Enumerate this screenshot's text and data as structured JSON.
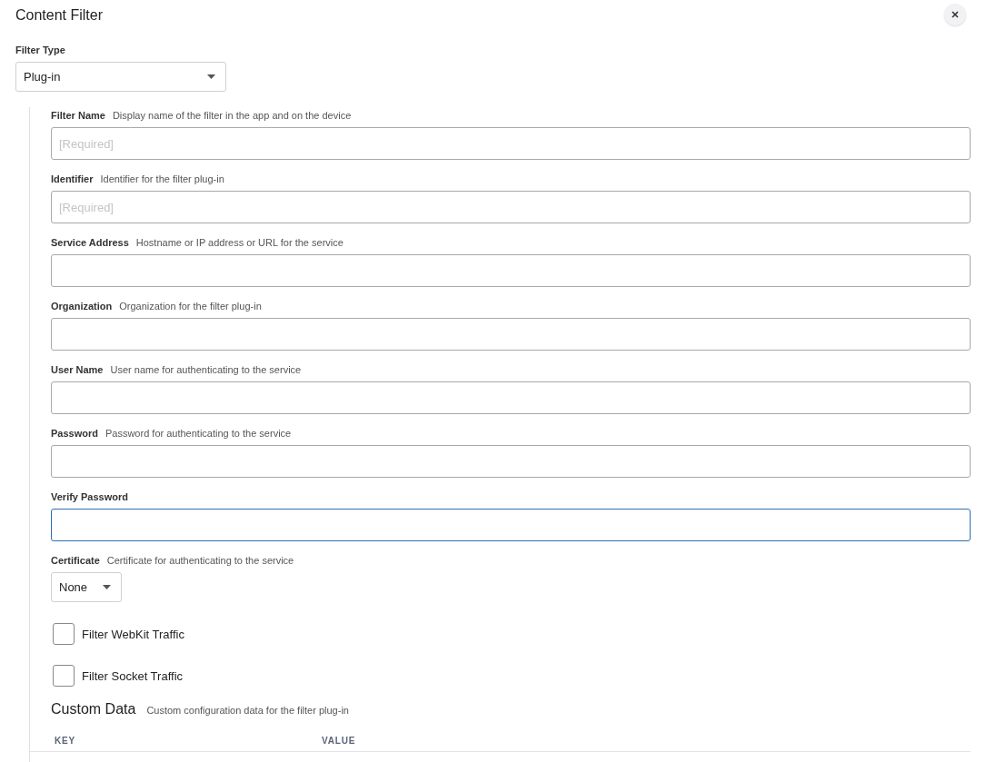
{
  "title": "Content Filter",
  "filter_type": {
    "label": "Filter Type",
    "value": "Plug-in"
  },
  "fields": [
    {
      "label": "Filter Name",
      "hint": "Display name of the filter in the app and on the device",
      "placeholder": "[Required]",
      "focused": false
    },
    {
      "label": "Identifier",
      "hint": "Identifier for the filter plug-in",
      "placeholder": "[Required]",
      "focused": false
    },
    {
      "label": "Service Address",
      "hint": "Hostname or IP address or URL for the service",
      "focused": false
    },
    {
      "label": "Organization",
      "hint": "Organization for the filter plug-in",
      "focused": false
    },
    {
      "label": "User Name",
      "hint": "User name for authenticating to the service",
      "focused": false
    },
    {
      "label": "Password",
      "hint": "Password for authenticating to the service",
      "focused": false
    },
    {
      "label": "Verify Password",
      "focused": true
    }
  ],
  "certificate": {
    "label": "Certificate",
    "hint": "Certificate for authenticating to the service",
    "value": "None"
  },
  "checkboxes": [
    {
      "label": "Filter WebKit Traffic",
      "checked": false
    },
    {
      "label": "Filter Socket Traffic",
      "checked": false
    }
  ],
  "custom_data": {
    "title": "Custom Data",
    "hint": "Custom configuration data for the filter plug-in",
    "columns": [
      "KEY",
      "VALUE"
    ]
  }
}
